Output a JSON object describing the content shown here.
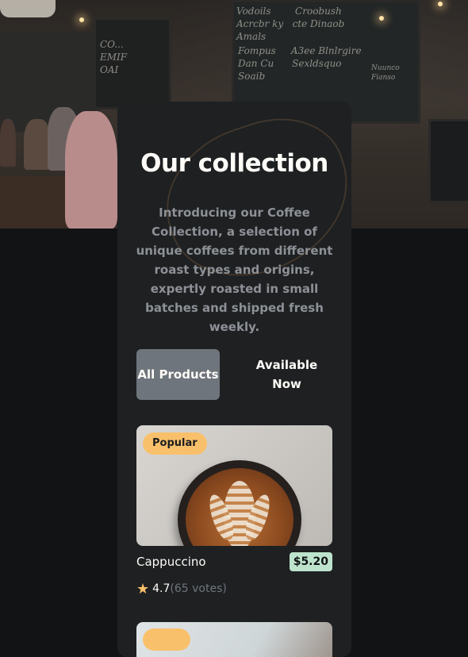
{
  "hero": {
    "chalk_left": "CO...\nEMIF\nOAI",
    "chalk_right_1": "Vodoils        Croobush\nAcrcbr ky   cte Dinaob\nAmals",
    "chalk_right_2": "Fompus     A3ee Blnlrgire\nDan Cu      Sexldsquo\nSoaib",
    "chalk_right_3": "Nuunco\nFianso"
  },
  "collection": {
    "title": "Our collection",
    "description": "Introducing our Coffee Collection, a selection of unique coffees from different roast types and origins, expertly roasted in small batches and shipped fresh weekly."
  },
  "tabs": [
    {
      "label": "All Products",
      "active": true
    },
    {
      "label": "Available Now",
      "active": false
    }
  ],
  "products": [
    {
      "badge": "Popular",
      "name": "Cappuccino",
      "price": "$5.20",
      "rating": "4.7",
      "votes": "(65 votes)"
    }
  ],
  "colors": {
    "background": "#111315",
    "card": "#1e2022",
    "accent_badge": "#f9c06b",
    "price_badge": "#bee3cc",
    "tab_active": "#6f757c",
    "muted_text": "#6f757c"
  },
  "icons": {
    "rating": "star-icon"
  }
}
